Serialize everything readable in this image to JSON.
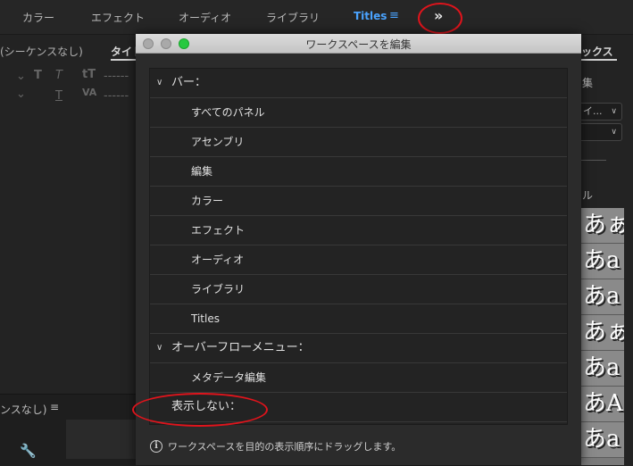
{
  "topbar": {
    "tabs": [
      "カラー",
      "エフェクト",
      "オーディオ",
      "ライブラリ"
    ],
    "active_tab": "Titles",
    "menu_icon": "hamburger-icon",
    "overflow_button": "»"
  },
  "left_panel": {
    "tab_label": "(シーケンスなし)",
    "title_tab": "タイト",
    "lower_title": "ンスなし)",
    "lower_menu_icon": "≡",
    "wrench_icon": "wrench-icon"
  },
  "right_panel": {
    "tab_label": "ックス",
    "label_edit": "集",
    "dropdown1": "イ...",
    "dropdown2": "",
    "label_style": "ル",
    "style_swatches": [
      "あぁ",
      "あa",
      "あa",
      "あぁ",
      "あa",
      "あA",
      "あa"
    ]
  },
  "dialog": {
    "title": "ワークスペースを編集",
    "sections": [
      {
        "label": "バー：",
        "items": [
          "すべてのパネル",
          "アセンブリ",
          "編集",
          "カラー",
          "エフェクト",
          "オーディオ",
          "ライブラリ",
          "Titles"
        ]
      },
      {
        "label": "オーバーフローメニュー：",
        "items": [
          "メタデータ編集"
        ]
      },
      {
        "label": "表示しない："
      }
    ],
    "footer": "ワークスペースを目的の表示順序にドラッグします。"
  }
}
